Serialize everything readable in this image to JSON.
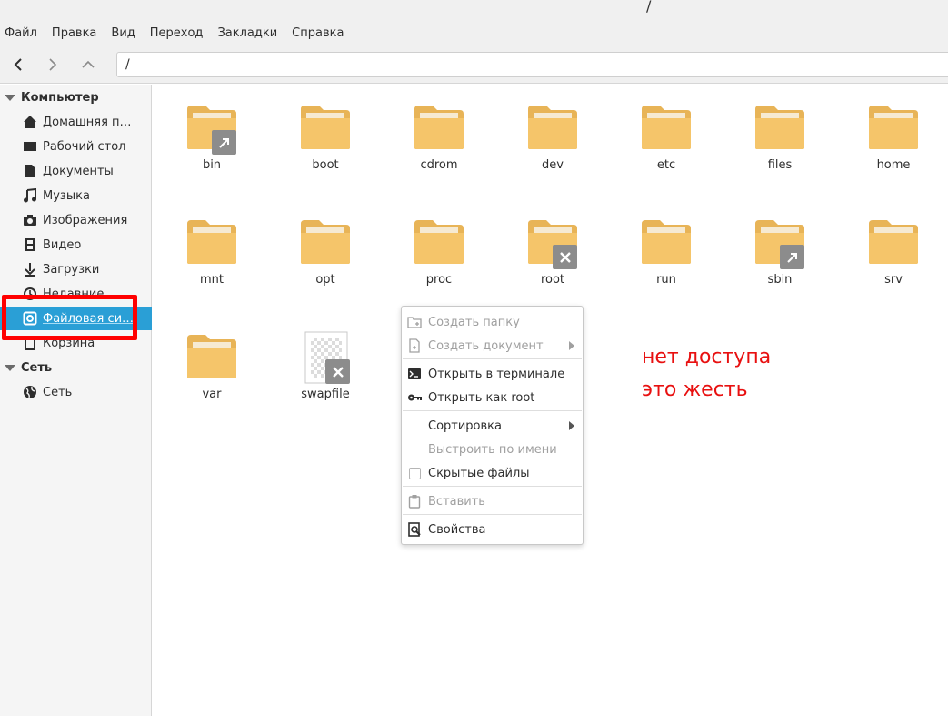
{
  "window": {
    "title": "/"
  },
  "menubar": {
    "items": [
      "Файл",
      "Правка",
      "Вид",
      "Переход",
      "Закладки",
      "Справка"
    ]
  },
  "toolbar": {
    "back_icon": "chevron-left-icon",
    "forward_icon": "chevron-right-icon",
    "up_icon": "chevron-up-icon",
    "path": "/"
  },
  "sidebar": {
    "computer_header": "Компьютер",
    "items": [
      {
        "label": "Домашняя п…",
        "icon": "home-icon"
      },
      {
        "label": "Рабочий стол",
        "icon": "desktop-icon"
      },
      {
        "label": "Документы",
        "icon": "document-icon"
      },
      {
        "label": "Музыка",
        "icon": "music-icon"
      },
      {
        "label": "Изображения",
        "icon": "camera-icon"
      },
      {
        "label": "Видео",
        "icon": "film-icon"
      },
      {
        "label": "Загрузки",
        "icon": "download-icon"
      },
      {
        "label": "Недавние",
        "icon": "clock-icon"
      },
      {
        "label": "Файловая си…",
        "icon": "drive-icon",
        "selected": true
      },
      {
        "label": "Корзина",
        "icon": "trash-icon"
      }
    ],
    "network_header": "Сеть",
    "network_items": [
      {
        "label": "Сеть",
        "icon": "globe-icon"
      }
    ]
  },
  "files": [
    {
      "name": "bin",
      "emblem": "symlink"
    },
    {
      "name": "boot"
    },
    {
      "name": "cdrom"
    },
    {
      "name": "dev"
    },
    {
      "name": "etc"
    },
    {
      "name": "files"
    },
    {
      "name": "home"
    },
    {
      "name": "mnt"
    },
    {
      "name": "opt"
    },
    {
      "name": "proc"
    },
    {
      "name": "root",
      "emblem": "no-access"
    },
    {
      "name": "run"
    },
    {
      "name": "sbin",
      "emblem": "symlink"
    },
    {
      "name": "srv"
    },
    {
      "name": "var"
    },
    {
      "name": "swapfile",
      "emblem": "no-access",
      "kind": "file"
    }
  ],
  "context_menu": {
    "create_folder": "Создать папку",
    "create_document": "Создать документ",
    "open_terminal": "Открыть в терминале",
    "open_as_root": "Открыть как root",
    "sort": "Сортировка",
    "arrange_by_name": "Выстроить по имени",
    "hidden_files": "Скрытые файлы",
    "paste": "Вставить",
    "properties": "Свойства"
  },
  "annotation": {
    "line1": "нет доступа",
    "line2": "это жесть",
    "color": "#e81010",
    "box_color": "#ff0000"
  },
  "colors": {
    "accent": "#2a9fd6",
    "folder": "#f5c56a"
  }
}
